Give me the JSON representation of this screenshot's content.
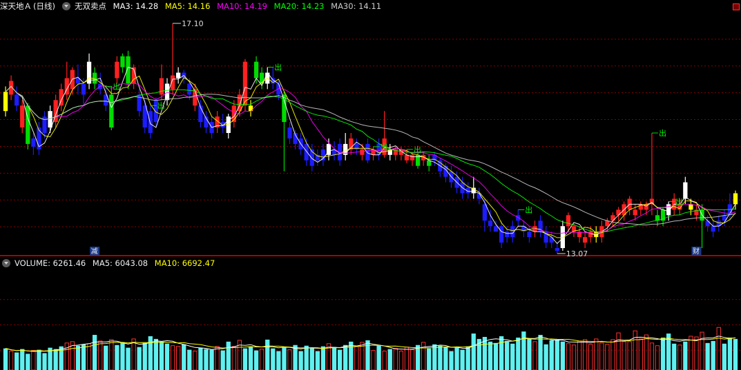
{
  "main_header": {
    "stock_name": "深天地Ａ",
    "period": "(日线)",
    "indicator": "无双卖点",
    "ma3_label": "MA3: 14.28",
    "ma5_label": "MA5: 14.16",
    "ma10_label": "MA10: 14.19",
    "ma20_label": "MA20: 14.23",
    "ma30_label": "MA30: 14.11"
  },
  "volume_header": {
    "volume_label": "VOLUME: 6261.46",
    "ma5_label": "MA5: 6043.08",
    "ma10_label": "MA10: 6692.47"
  },
  "colors": {
    "up": "#ff2020",
    "down": "#1c1cff",
    "buy": "#00dd00",
    "warn": "#ffff00",
    "neutral": "#ffffff",
    "ma3": "#ffffff",
    "ma5": "#ffff00",
    "ma10": "#ff00ff",
    "ma20": "#00ff00",
    "ma30": "#cccccc",
    "vol_up": "#ff3030",
    "vol_down": "#5ff0f0",
    "grid": "#8b0000"
  },
  "annotations": {
    "high_label": "17.10",
    "low_label": "13.07",
    "sell_signal": "出",
    "reduce_marker": "减",
    "finance_marker": "财"
  },
  "chart_data": [
    {
      "type": "candlestick",
      "title": "深天地Ａ (日线) 无双卖点",
      "ylim": [
        12.9,
        17.3
      ],
      "high": 17.1,
      "low": 13.07,
      "series": [
        {
          "name": "MA3",
          "value": 14.28
        },
        {
          "name": "MA5",
          "value": 14.16
        },
        {
          "name": "MA10",
          "value": 14.19
        },
        {
          "name": "MA20",
          "value": 14.23
        },
        {
          "name": "MA30",
          "value": 14.11
        }
      ],
      "candles": [
        [
          15.5,
          15.85,
          15.95,
          15.4,
          "warn"
        ],
        [
          15.8,
          16.05,
          16.15,
          15.7,
          "up"
        ],
        [
          15.8,
          15.6,
          15.95,
          15.5,
          "down"
        ],
        [
          15.2,
          15.6,
          15.7,
          15.1,
          "up"
        ],
        [
          15.6,
          14.9,
          15.65,
          14.8,
          "buy"
        ],
        [
          15.0,
          14.85,
          15.1,
          14.7,
          "down"
        ],
        [
          15.2,
          14.8,
          15.3,
          14.7,
          "down"
        ],
        [
          15.4,
          15.1,
          15.5,
          15.0,
          "down"
        ],
        [
          15.2,
          15.5,
          15.6,
          15.1,
          "neutral"
        ],
        [
          15.3,
          15.7,
          15.8,
          15.2,
          "up"
        ],
        [
          15.6,
          15.9,
          16.0,
          15.5,
          "up"
        ],
        [
          15.8,
          16.1,
          16.4,
          15.7,
          "up"
        ],
        [
          15.9,
          16.25,
          16.3,
          15.8,
          "up"
        ],
        [
          16.1,
          16.0,
          16.35,
          15.8,
          "down"
        ],
        [
          16.0,
          15.8,
          16.1,
          15.6,
          "down"
        ],
        [
          16.0,
          16.4,
          16.55,
          15.9,
          "neutral"
        ],
        [
          16.2,
          16.0,
          16.3,
          15.9,
          "buy"
        ],
        [
          16.0,
          15.9,
          16.2,
          15.8,
          "down"
        ],
        [
          15.8,
          15.6,
          15.95,
          15.5,
          "down"
        ],
        [
          15.8,
          15.2,
          15.95,
          15.15,
          "buy"
        ],
        [
          16.1,
          16.4,
          16.5,
          16.0,
          "up"
        ],
        [
          16.3,
          16.5,
          16.55,
          16.2,
          "buy"
        ],
        [
          16.5,
          16.0,
          16.6,
          15.9,
          "buy"
        ],
        [
          16.0,
          16.3,
          16.35,
          15.9,
          "up"
        ],
        [
          15.8,
          15.5,
          15.9,
          15.4,
          "down"
        ],
        [
          15.6,
          15.2,
          15.7,
          15.1,
          "down"
        ],
        [
          15.5,
          15.1,
          15.6,
          15.0,
          "down"
        ],
        [
          15.7,
          15.3,
          15.75,
          15.2,
          "down"
        ],
        [
          15.8,
          16.1,
          16.35,
          15.7,
          "up"
        ],
        [
          15.7,
          16.0,
          16.1,
          15.6,
          "neutral"
        ],
        [
          15.9,
          16.15,
          17.1,
          15.8,
          "up"
        ],
        [
          16.2,
          16.1,
          16.3,
          16.0,
          "neutral"
        ],
        [
          16.1,
          16.2,
          16.25,
          16.0,
          "down"
        ],
        [
          16.0,
          15.8,
          16.1,
          15.7,
          "down"
        ],
        [
          15.9,
          15.6,
          16.0,
          15.5,
          "up"
        ],
        [
          15.6,
          15.3,
          15.7,
          15.2,
          "down"
        ],
        [
          15.4,
          15.2,
          15.5,
          15.1,
          "down"
        ],
        [
          15.3,
          15.1,
          15.4,
          15.0,
          "down"
        ],
        [
          15.2,
          15.4,
          15.5,
          15.1,
          "up"
        ],
        [
          15.3,
          15.2,
          15.45,
          15.1,
          "down"
        ],
        [
          15.1,
          15.4,
          15.45,
          15.0,
          "neutral"
        ],
        [
          15.3,
          15.6,
          15.7,
          15.2,
          "up"
        ],
        [
          15.5,
          15.8,
          15.9,
          15.4,
          "up"
        ],
        [
          15.6,
          16.4,
          16.45,
          15.5,
          "up"
        ],
        [
          15.6,
          15.5,
          15.7,
          15.4,
          "warn"
        ],
        [
          16.1,
          16.4,
          16.5,
          16.0,
          "buy"
        ],
        [
          16.2,
          16.0,
          16.3,
          15.9,
          "buy"
        ],
        [
          16.0,
          16.2,
          16.3,
          15.9,
          "neutral"
        ],
        [
          16.1,
          16.0,
          16.3,
          15.9,
          "down"
        ],
        [
          16.0,
          15.8,
          16.05,
          15.7,
          "down"
        ],
        [
          15.8,
          15.3,
          15.85,
          14.4,
          "buy"
        ],
        [
          15.2,
          15.0,
          15.3,
          14.9,
          "down"
        ],
        [
          15.1,
          14.9,
          15.15,
          14.8,
          "down"
        ],
        [
          15.0,
          14.8,
          15.1,
          14.7,
          "down"
        ],
        [
          14.9,
          14.6,
          15.0,
          14.5,
          "down"
        ],
        [
          14.8,
          14.5,
          14.9,
          14.4,
          "down"
        ],
        [
          14.7,
          14.6,
          14.8,
          14.5,
          "down"
        ],
        [
          14.6,
          14.8,
          14.9,
          14.5,
          "down"
        ],
        [
          14.7,
          14.9,
          15.0,
          14.6,
          "neutral"
        ],
        [
          14.8,
          14.7,
          14.95,
          14.6,
          "down"
        ],
        [
          14.9,
          14.6,
          15.0,
          14.5,
          "down"
        ],
        [
          14.7,
          14.9,
          15.1,
          14.6,
          "neutral"
        ],
        [
          14.8,
          15.0,
          15.1,
          14.7,
          "up"
        ],
        [
          14.8,
          14.9,
          15.0,
          14.7,
          "down"
        ],
        [
          14.8,
          14.7,
          14.9,
          14.6,
          "up"
        ],
        [
          14.9,
          14.6,
          15.0,
          14.55,
          "down"
        ],
        [
          14.7,
          14.8,
          14.85,
          14.6,
          "up"
        ],
        [
          14.9,
          14.7,
          15.0,
          14.6,
          "down"
        ],
        [
          14.7,
          15.0,
          15.5,
          14.65,
          "up"
        ],
        [
          14.7,
          14.8,
          14.9,
          14.6,
          "neutral"
        ],
        [
          14.7,
          14.8,
          14.85,
          14.6,
          "up"
        ],
        [
          14.8,
          14.7,
          14.85,
          14.6,
          "up"
        ],
        [
          14.7,
          14.6,
          14.8,
          14.55,
          "up"
        ],
        [
          14.6,
          14.7,
          14.75,
          14.5,
          "up"
        ],
        [
          14.5,
          14.7,
          14.75,
          14.45,
          "buy"
        ],
        [
          14.7,
          14.6,
          14.75,
          14.5,
          "up"
        ],
        [
          14.6,
          14.5,
          14.7,
          14.4,
          "buy"
        ],
        [
          14.7,
          14.6,
          14.75,
          14.5,
          "down"
        ],
        [
          14.6,
          14.4,
          14.65,
          14.3,
          "down"
        ],
        [
          14.5,
          14.3,
          14.55,
          14.2,
          "down"
        ],
        [
          14.4,
          14.2,
          14.5,
          14.1,
          "down"
        ],
        [
          14.3,
          14.1,
          14.4,
          14.0,
          "down"
        ],
        [
          14.2,
          14.0,
          14.3,
          13.9,
          "down"
        ],
        [
          14.1,
          14.0,
          14.2,
          13.9,
          "down"
        ],
        [
          14.0,
          14.1,
          14.3,
          13.9,
          "neutral"
        ],
        [
          14.0,
          13.9,
          14.1,
          13.8,
          "down"
        ],
        [
          13.8,
          13.5,
          13.9,
          13.3,
          "down"
        ],
        [
          13.5,
          13.4,
          13.7,
          13.3,
          "down"
        ],
        [
          13.3,
          13.4,
          13.5,
          13.3,
          "down"
        ],
        [
          13.4,
          13.1,
          13.5,
          13.0,
          "down"
        ],
        [
          13.2,
          13.3,
          13.4,
          13.1,
          "down"
        ],
        [
          13.2,
          13.4,
          13.5,
          13.1,
          "down"
        ],
        [
          13.6,
          13.5,
          13.7,
          13.4,
          "down"
        ],
        [
          13.4,
          13.3,
          13.5,
          13.2,
          "down"
        ],
        [
          13.3,
          13.2,
          13.4,
          13.1,
          "down"
        ],
        [
          13.3,
          13.4,
          13.5,
          13.2,
          "up"
        ],
        [
          13.5,
          13.3,
          13.6,
          13.2,
          "down"
        ],
        [
          13.3,
          13.1,
          13.4,
          13.0,
          "down"
        ],
        [
          13.1,
          13.2,
          13.3,
          13.0,
          "down"
        ],
        [
          13.0,
          12.95,
          13.1,
          12.9,
          "down"
        ],
        [
          13.0,
          13.4,
          13.5,
          12.95,
          "neutral"
        ],
        [
          13.4,
          13.6,
          13.65,
          13.3,
          "up"
        ],
        [
          13.3,
          13.4,
          13.45,
          13.2,
          "up"
        ],
        [
          13.2,
          13.3,
          13.4,
          13.1,
          "up"
        ],
        [
          13.1,
          13.2,
          13.3,
          13.0,
          "up"
        ],
        [
          13.2,
          13.3,
          13.4,
          13.1,
          "up"
        ],
        [
          13.3,
          13.2,
          13.4,
          13.1,
          "warn"
        ],
        [
          13.2,
          13.4,
          13.5,
          13.1,
          "up"
        ],
        [
          13.4,
          13.5,
          13.55,
          13.3,
          "up"
        ],
        [
          13.5,
          13.6,
          13.65,
          13.4,
          "up"
        ],
        [
          13.6,
          13.7,
          13.75,
          13.5,
          "up"
        ],
        [
          13.6,
          13.8,
          13.85,
          13.5,
          "up"
        ],
        [
          13.7,
          13.9,
          13.95,
          13.6,
          "up"
        ],
        [
          13.6,
          13.7,
          13.8,
          13.5,
          "up"
        ],
        [
          13.7,
          13.8,
          13.85,
          13.6,
          "up"
        ],
        [
          13.7,
          13.8,
          13.85,
          13.6,
          "up"
        ],
        [
          13.8,
          13.9,
          15.1,
          13.6,
          "up"
        ],
        [
          13.6,
          13.5,
          13.7,
          13.4,
          "buy"
        ],
        [
          13.5,
          13.7,
          13.75,
          13.4,
          "buy"
        ],
        [
          13.6,
          13.8,
          13.85,
          13.5,
          "neutral"
        ],
        [
          13.7,
          13.9,
          14.0,
          13.6,
          "up"
        ],
        [
          13.8,
          13.7,
          13.9,
          13.6,
          "up"
        ],
        [
          13.9,
          14.2,
          14.3,
          13.8,
          "neutral"
        ],
        [
          13.8,
          13.7,
          13.9,
          13.6,
          "warn"
        ],
        [
          13.7,
          13.6,
          13.8,
          13.5,
          "up"
        ],
        [
          13.7,
          13.5,
          13.8,
          13.0,
          "buy"
        ],
        [
          13.5,
          13.4,
          13.6,
          13.3,
          "down"
        ],
        [
          13.4,
          13.3,
          13.5,
          13.2,
          "down"
        ],
        [
          13.4,
          13.5,
          13.6,
          13.3,
          "down"
        ],
        [
          13.5,
          13.6,
          13.7,
          13.4,
          "down"
        ],
        [
          13.6,
          13.8,
          14.0,
          13.5,
          "down"
        ],
        [
          13.8,
          14.0,
          14.05,
          13.7,
          "warn"
        ]
      ]
    },
    {
      "type": "bar",
      "title": "VOLUME",
      "ylim": [
        0,
        15000
      ],
      "series": [
        {
          "name": "VOLUME",
          "value": 6261.46
        },
        {
          "name": "MA5",
          "value": 6043.08
        },
        {
          "name": "MA10",
          "value": 6692.47
        }
      ],
      "values": [
        3200,
        2800,
        2600,
        3100,
        2400,
        2900,
        3000,
        2500,
        3300,
        3100,
        3500,
        4000,
        4200,
        3600,
        3800,
        3900,
        5200,
        4300,
        3600,
        4500,
        3700,
        4100,
        3300,
        4600,
        3400,
        4000,
        5000,
        4600,
        4200,
        3900,
        3600,
        3500,
        3800,
        3000,
        2800,
        3300,
        3100,
        3000,
        3500,
        2900,
        4200,
        3500,
        4400,
        3200,
        3500,
        2900,
        3100,
        4500,
        3200,
        2800,
        3300,
        3000,
        3700,
        2800,
        3600,
        3200,
        2800,
        3500,
        3900,
        3400,
        3000,
        3700,
        4200,
        3500,
        4100,
        4400,
        2900,
        3600,
        2800,
        3100,
        3200,
        2800,
        3400,
        3000,
        3700,
        4100,
        3200,
        3800,
        3600,
        3400,
        2800,
        3300,
        3000,
        3500,
        5400,
        4600,
        4900,
        4200,
        4000,
        5000,
        4300,
        3900,
        4800,
        5700,
        4700,
        4200,
        5200,
        3800,
        4400,
        4500,
        4200,
        3900,
        3700,
        4300,
        4500,
        3800,
        4600,
        4000,
        3800,
        4500,
        5500,
        4200,
        4200,
        5800,
        4600,
        5200,
        4000,
        3600,
        4800,
        5400,
        3900,
        3700,
        4200,
        5000,
        4900,
        5600,
        4000,
        4300,
        6300,
        3900,
        4800,
        4600,
        4700,
        3700,
        4200,
        6261
      ],
      "up_flags": [
        0,
        1,
        0,
        0,
        0,
        1,
        0,
        0,
        0,
        0,
        0,
        1,
        1,
        0,
        0,
        1,
        0,
        1,
        0,
        1,
        0,
        0,
        0,
        1,
        0,
        0,
        0,
        0,
        0,
        0,
        1,
        1,
        0,
        0,
        1,
        0,
        0,
        0,
        1,
        0,
        0,
        1,
        1,
        0,
        0,
        0,
        1,
        0,
        0,
        0,
        0,
        1,
        0,
        0,
        0,
        0,
        0,
        0,
        1,
        0,
        0,
        0,
        0,
        1,
        1,
        0,
        1,
        0,
        1,
        0,
        1,
        1,
        1,
        1,
        0,
        1,
        0,
        0,
        0,
        0,
        0,
        0,
        0,
        0,
        0,
        0,
        0,
        0,
        0,
        0,
        0,
        0,
        0,
        0,
        0,
        1,
        0,
        0,
        0,
        0,
        0,
        1,
        1,
        1,
        1,
        1,
        1,
        1,
        1,
        1,
        1,
        1,
        1,
        1,
        1,
        1,
        1,
        1,
        0,
        0,
        0,
        1,
        0,
        1,
        1,
        1,
        0,
        0,
        1,
        0,
        0,
        0,
        0,
        0,
        0,
        0
      ]
    }
  ]
}
